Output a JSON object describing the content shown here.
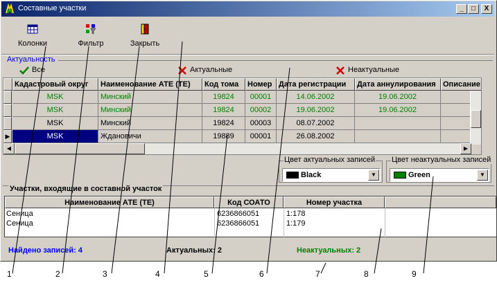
{
  "window": {
    "title": "Составные участки",
    "buttons": [
      "_",
      "□",
      "X"
    ]
  },
  "toolbar": {
    "columns_label": "Колонки",
    "filter_label": "Фильтр",
    "close_label": "Закрыть"
  },
  "actuality": {
    "legend": "Актуальность",
    "all_label": "Все",
    "actual_label": "Актуальные",
    "nonactual_label": "Неактуальные"
  },
  "grid": {
    "columns": [
      "Кадастровый округ",
      "Наименование АТЕ (ТЕ)",
      "Код тома",
      "Номер",
      "Дата регистрации",
      "Дата аннулирования",
      "Описание"
    ],
    "rows": [
      {
        "okrug": "MSK",
        "ate": "Минский",
        "kod": "19824",
        "nomer": "00001",
        "reg": "14.06.2002",
        "ann": "19.06.2002",
        "color": "#008000",
        "selected": false
      },
      {
        "okrug": "MSK",
        "ate": "Минский",
        "kod": "19824",
        "nomer": "00002",
        "reg": "19.06.2002",
        "ann": "19.06.2002",
        "color": "#008000",
        "selected": false
      },
      {
        "okrug": "MSK",
        "ate": "Минский",
        "kod": "19824",
        "nomer": "00003",
        "reg": "08.07.2002",
        "ann": "",
        "color": "#000000",
        "selected": false
      },
      {
        "okrug": "MSK",
        "ate": "Ждановичи",
        "kod": "19889",
        "nomer": "00001",
        "reg": "26.08.2002",
        "ann": "",
        "color": "#000000",
        "selected": true
      }
    ]
  },
  "colors": {
    "actual_legend": "Цвет актуальных записей",
    "actual_value": "Black",
    "actual_swatch": "#000000",
    "nonactual_legend": "Цвет неактуальных записей",
    "nonactual_value": "Green",
    "nonactual_swatch": "#008000"
  },
  "parcels": {
    "title": "Участки, входящие в составной участок",
    "columns": [
      "Наименование АТЕ (ТЕ)",
      "Код СОАТО",
      "Номер участка"
    ],
    "rows": [
      {
        "ate": "Сеница",
        "soato": "6236866051",
        "num": "1:178"
      },
      {
        "ate": "Сеница",
        "soato": "6236866051",
        "num": "1:179"
      }
    ]
  },
  "status": {
    "found": "Найдено записей: 4",
    "actual": "Актуальных: 2",
    "nonactual": "Неактуальных: 2",
    "found_color": "#0000ff",
    "nonactual_color": "#008000"
  },
  "callouts": [
    "1",
    "2",
    "3",
    "4",
    "5",
    "6",
    "7",
    "8",
    "9"
  ]
}
